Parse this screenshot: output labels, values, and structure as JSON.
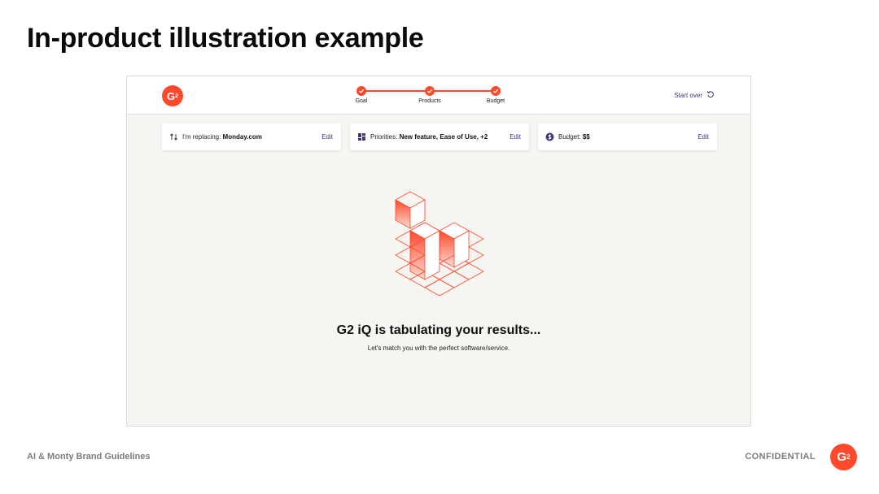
{
  "slide": {
    "title": "In-product illustration example",
    "footer_left": "AI & Monty Brand Guidelines",
    "footer_right": "CONFIDENTIAL"
  },
  "colors": {
    "brand": "#ff492c",
    "link": "#3d3a7a",
    "canvas": "#f7f5f2"
  },
  "app": {
    "logo_icon": "g2-logo-icon",
    "stepper": {
      "steps": [
        {
          "label": "Goal",
          "status": "complete"
        },
        {
          "label": "Products",
          "status": "complete"
        },
        {
          "label": "Budget",
          "status": "complete"
        }
      ]
    },
    "start_over_label": "Start over",
    "chips": [
      {
        "icon": "swap-icon",
        "label": "I'm replacing: ",
        "value": "Monday.com",
        "edit": "Edit"
      },
      {
        "icon": "grid-icon",
        "label": "Priorities: ",
        "value": "New feature, Ease of Use, +2",
        "edit": "Edit"
      },
      {
        "icon": "dollar-icon",
        "label": "Budget: ",
        "value": "$$",
        "edit": "Edit"
      }
    ],
    "loading": {
      "title": "G2 iQ is tabulating your results...",
      "subtitle": "Let's match you with the perfect software/service."
    }
  }
}
